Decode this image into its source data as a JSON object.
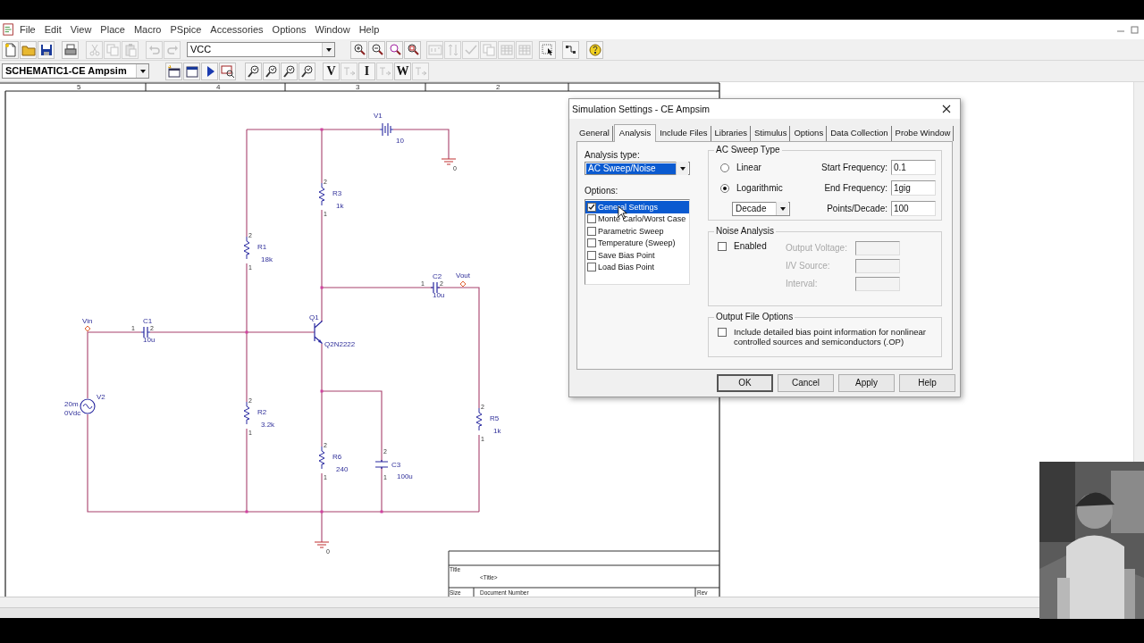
{
  "menu": [
    "File",
    "Edit",
    "View",
    "Place",
    "Macro",
    "PSpice",
    "Accessories",
    "Options",
    "Window",
    "Help"
  ],
  "toolbar_1": {
    "part_field": "VCC",
    "buttons": [
      {
        "disabled": false
      },
      {
        "disabled": false
      },
      {
        "disabled": false
      },
      {
        "disabled": false
      },
      {
        "disabled": true
      },
      {
        "disabled": true
      },
      {
        "disabled": true
      },
      {
        "disabled": true
      },
      {
        "disabled": true
      },
      {
        "disabled": false
      },
      {
        "disabled": false
      },
      {
        "disabled": false
      },
      {
        "disabled": false
      },
      {
        "disabled": true
      },
      {
        "disabled": true
      },
      {
        "disabled": true
      },
      {
        "disabled": true
      },
      {
        "disabled": true
      },
      {
        "disabled": true
      },
      {
        "disabled": false
      },
      {
        "disabled": false
      },
      {
        "disabled": false
      }
    ]
  },
  "toolbar_2": {
    "schematic_field": "SCHEMATIC1-CE Ampsim",
    "buttons": [
      {
        "kind": "icon",
        "disabled": false
      },
      {
        "kind": "icon",
        "disabled": false
      },
      {
        "kind": "icon",
        "disabled": false
      },
      {
        "kind": "icon",
        "disabled": false
      },
      {
        "kind": "icon",
        "disabled": false
      },
      {
        "kind": "icon",
        "disabled": false
      },
      {
        "kind": "icon",
        "disabled": false
      },
      {
        "kind": "icon",
        "disabled": false
      },
      {
        "kind": "text",
        "label": "V",
        "disabled": false
      },
      {
        "kind": "icon",
        "disabled": true
      },
      {
        "kind": "text",
        "label": "I",
        "disabled": false
      },
      {
        "kind": "icon",
        "disabled": true
      },
      {
        "kind": "text",
        "label": "W",
        "disabled": false
      },
      {
        "kind": "icon",
        "disabled": true
      }
    ]
  },
  "ruler": [
    "5",
    "4",
    "3",
    "2"
  ],
  "schematic": {
    "components": [
      {
        "kind": "battery",
        "ref": "V1",
        "value": "10"
      },
      {
        "kind": "resistor",
        "ref": "R3",
        "value": "1k",
        "pins": [
          "2",
          "1"
        ]
      },
      {
        "kind": "resistor",
        "ref": "R1",
        "value": "18k",
        "pins": [
          "2",
          "1"
        ]
      },
      {
        "kind": "capacitor",
        "ref": "C2",
        "value": "10u",
        "pins": [
          "1",
          "2"
        ]
      },
      {
        "kind": "capacitor",
        "ref": "C1",
        "value": "10u",
        "pins": [
          "1",
          "2"
        ]
      },
      {
        "kind": "transistor",
        "ref": "Q1",
        "value": "Q2N2222"
      },
      {
        "kind": "source",
        "ref": "V2",
        "value": "20m",
        "dc": "0Vdc"
      },
      {
        "kind": "resistor",
        "ref": "R2",
        "value": "3.2k",
        "pins": [
          "2",
          "1"
        ]
      },
      {
        "kind": "resistor",
        "ref": "R6",
        "value": "240",
        "pins": [
          "2",
          "1"
        ]
      },
      {
        "kind": "capacitor",
        "ref": "C3",
        "value": "100u",
        "pins": [
          "2",
          "1"
        ]
      },
      {
        "kind": "resistor",
        "ref": "R5",
        "value": "1k",
        "pins": [
          "2",
          "1"
        ]
      }
    ],
    "nets": [
      {
        "label": "Vin"
      },
      {
        "label": "Vout"
      }
    ],
    "grounds": [
      {
        "label": "0"
      },
      {
        "label": "0"
      }
    ]
  },
  "title_block": {
    "title_label": "Title",
    "title": "<Title>",
    "size_label": "Size",
    "document_label": "Document Number",
    "rev_label": "Rev"
  },
  "dialog": {
    "title": "Simulation Settings - CE Ampsim",
    "tabs": [
      {
        "label": "General",
        "selected": false
      },
      {
        "label": "Analysis",
        "selected": true
      },
      {
        "label": "Include Files",
        "selected": false
      },
      {
        "label": "Libraries",
        "selected": false
      },
      {
        "label": "Stimulus",
        "selected": false
      },
      {
        "label": "Options",
        "selected": false
      },
      {
        "label": "Data Collection",
        "selected": false
      },
      {
        "label": "Probe Window",
        "selected": false
      }
    ],
    "analysis_type": {
      "label": "Analysis type:",
      "value": "AC Sweep/Noise",
      "highlighted": true
    },
    "options": {
      "label": "Options:",
      "items": [
        {
          "label": "General Settings",
          "checked": true,
          "selected": true
        },
        {
          "label": "Monte Carlo/Worst Case",
          "checked": false,
          "selected": false
        },
        {
          "label": "Parametric Sweep",
          "checked": false,
          "selected": false
        },
        {
          "label": "Temperature (Sweep)",
          "checked": false,
          "selected": false
        },
        {
          "label": "Save Bias Point",
          "checked": false,
          "selected": false
        },
        {
          "label": "Load Bias Point",
          "checked": false,
          "selected": false
        }
      ]
    },
    "ac_sweep": {
      "title": "AC Sweep Type",
      "types": [
        {
          "label": "Linear",
          "selected": false
        },
        {
          "label": "Logarithmic",
          "selected": true
        }
      ],
      "scale": "Decade",
      "fields": [
        {
          "label": "Start Frequency:",
          "value": "0.1"
        },
        {
          "label": "End Frequency:",
          "value": "1gig"
        },
        {
          "label": "Points/Decade:",
          "value": "100"
        }
      ]
    },
    "noise": {
      "title": "Noise Analysis",
      "enabled_label": "Enabled",
      "enabled": false,
      "fields": [
        {
          "label": "Output Voltage:",
          "disabled": true
        },
        {
          "label": "I/V Source:",
          "disabled": true
        },
        {
          "label": "Interval:",
          "disabled": true
        }
      ]
    },
    "output_file": {
      "title": "Output File Options",
      "label": "Include detailed bias point information for nonlinear controlled sources and semiconductors (.OP)",
      "checked": false
    },
    "buttons": [
      {
        "label": "OK",
        "default": true
      },
      {
        "label": "Cancel",
        "default": false
      },
      {
        "label": "Apply",
        "default": false
      },
      {
        "label": "Help",
        "default": false
      }
    ]
  },
  "webcam": {
    "kind": "picture"
  }
}
